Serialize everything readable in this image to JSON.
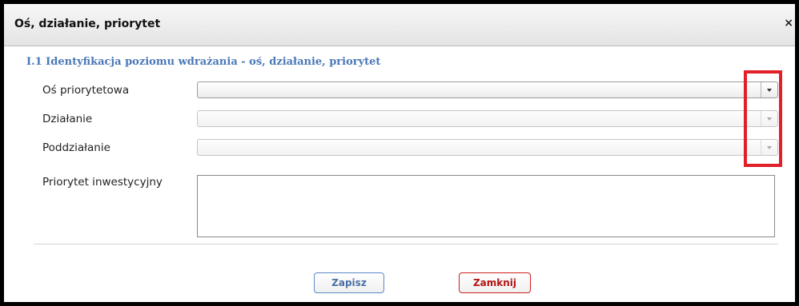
{
  "dialog": {
    "title": "Oś, działanie, priorytet",
    "close_glyph": "×"
  },
  "section": {
    "heading": "I.1 Identyfikacja poziomu wdrażania - oś, działanie, priorytet"
  },
  "form": {
    "os_priorytetowa": {
      "label": "Oś priorytetowa",
      "value": "",
      "enabled": true
    },
    "dzialanie": {
      "label": "Działanie",
      "value": "",
      "enabled": false
    },
    "poddzialanie": {
      "label": "Poddziałanie",
      "value": "",
      "enabled": false
    },
    "priorytet": {
      "label": "Priorytet inwestycyjny",
      "value": ""
    }
  },
  "buttons": {
    "save": "Zapisz",
    "close": "Zamknij"
  },
  "colors": {
    "heading": "#4a78b8",
    "annotation": "#e01f26",
    "save_border": "#5b89c4",
    "close_border": "#cc1f1f"
  }
}
